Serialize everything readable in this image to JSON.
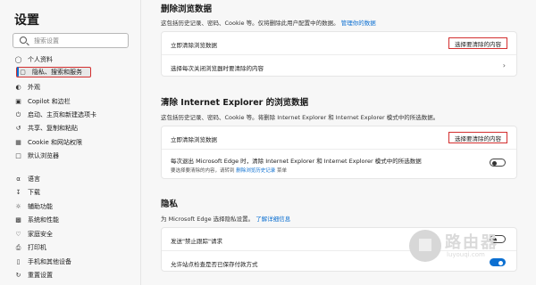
{
  "sidebar": {
    "title": "设置",
    "search_placeholder": "搜索设置",
    "items": [
      {
        "label": "个人资料",
        "icon": "person-icon"
      },
      {
        "label": "隐私、搜索和服务",
        "icon": "lock-icon",
        "active": true
      },
      {
        "label": "外观",
        "icon": "appearance-icon"
      },
      {
        "label": "Copilot 和边栏",
        "icon": "sidebar-icon"
      },
      {
        "label": "启动、主页和新建选项卡",
        "icon": "power-icon"
      },
      {
        "label": "共享、复制和粘贴",
        "icon": "share-icon"
      },
      {
        "label": "Cookie 和网站权限",
        "icon": "permissions-icon"
      },
      {
        "label": "默认浏览器",
        "icon": "browser-icon"
      },
      {
        "label": "语言",
        "icon": "language-icon"
      },
      {
        "label": "下载",
        "icon": "download-icon"
      },
      {
        "label": "辅助功能",
        "icon": "accessibility-icon"
      },
      {
        "label": "系统和性能",
        "icon": "system-icon"
      },
      {
        "label": "家庭安全",
        "icon": "family-icon"
      },
      {
        "label": "打印机",
        "icon": "printer-icon"
      },
      {
        "label": "手机和其他设备",
        "icon": "phone-icon"
      },
      {
        "label": "重置设置",
        "icon": "reset-icon"
      }
    ]
  },
  "clear_data": {
    "title": "删除浏览数据",
    "desc": "这包括历史记录、密码、Cookie 等。仅将删除此用户配置中的数据。",
    "desc_link": "管理你的数据",
    "row1_label": "立即清除浏览数据",
    "row1_button": "选择要清除的内容",
    "row2_label": "选择每次关闭浏览器时要清除的内容"
  },
  "ie_data": {
    "title": "清除 Internet Explorer 的浏览数据",
    "desc": "这包括历史记录、密码、Cookie 等。将删除 Internet Explorer 和 Internet Explorer 模式中的所选数据。",
    "row1_label": "立即清除浏览数据",
    "row1_button": "选择要清除的内容",
    "row2_label": "每次退出 Microsoft Edge 时，清除 Internet Explorer 和 Internet Explorer 模式中的所选数据",
    "row2_sub": "要选择要清除的内容，请转到",
    "row2_sub_link": "删除浏览历史记录",
    "row2_sub_tail": "菜单",
    "row2_toggle_on": false
  },
  "privacy": {
    "title": "隐私",
    "desc": "为 Microsoft Edge 选择隐私设置。",
    "desc_link": "了解详细信息",
    "row1_label": "发送\"禁止跟踪\"请求",
    "row1_toggle_on": false,
    "row2_label": "允许站点检查是否已保存付款方式",
    "row2_toggle_on": true
  },
  "watermark": {
    "cn": "路由器",
    "en": "luyouqi.com"
  },
  "colors": {
    "accent": "#0b6fd1",
    "highlight_border": "#d32f2f"
  }
}
